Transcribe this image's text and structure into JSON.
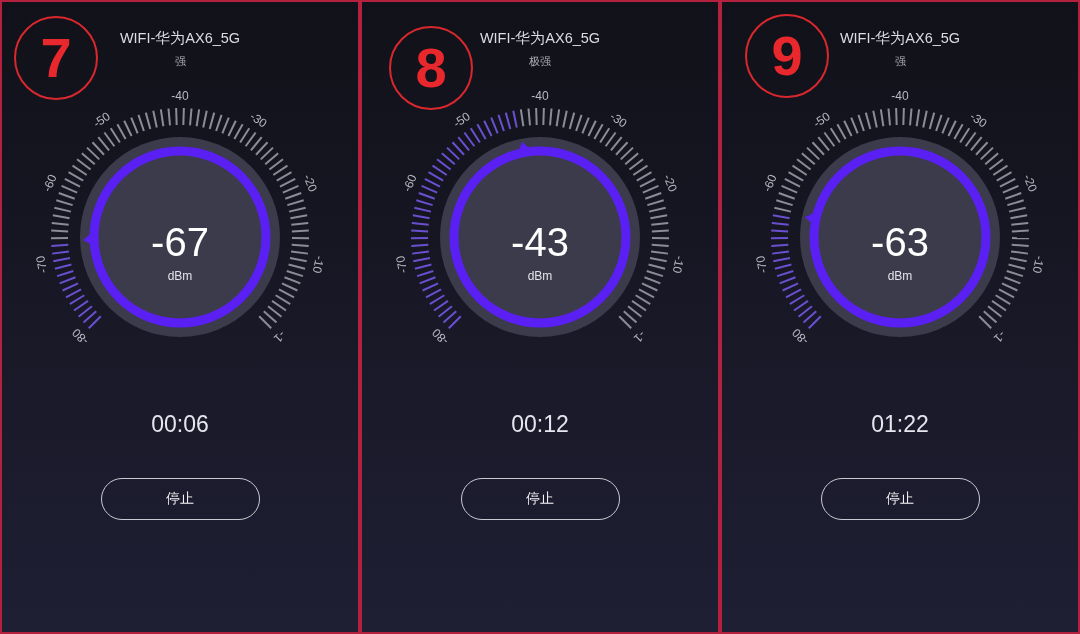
{
  "panels": [
    {
      "annotation": "7",
      "network": "WIFI-华为AX6_5G",
      "strength": "强",
      "gauge": {
        "scale_labels": [
          "-80",
          "-70",
          "-60",
          "-50",
          "-40",
          "-30",
          "-20",
          "-10",
          "-1"
        ],
        "level": 0.1625,
        "reading": "-67",
        "unit": "dBm"
      },
      "elapsed": "00:06",
      "button": "停止"
    },
    {
      "annotation": "8",
      "network": "WIFI-华为AX6_5G",
      "strength": "极强",
      "gauge": {
        "scale_labels": [
          "-80",
          "-70",
          "-60",
          "-50",
          "-40",
          "-30",
          "-20",
          "-10",
          "-1"
        ],
        "level": 0.4625,
        "reading": "-43",
        "unit": "dBm"
      },
      "elapsed": "00:12",
      "button": "停止"
    },
    {
      "annotation": "9",
      "network": "WIFI-华为AX6_5G",
      "strength": "强",
      "gauge": {
        "scale_labels": [
          "-80",
          "-70",
          "-60",
          "-50",
          "-40",
          "-30",
          "-20",
          "-10",
          "-1"
        ],
        "level": 0.2125,
        "reading": "-63",
        "unit": "dBm"
      },
      "elapsed": "01:22",
      "button": "停止"
    }
  ]
}
